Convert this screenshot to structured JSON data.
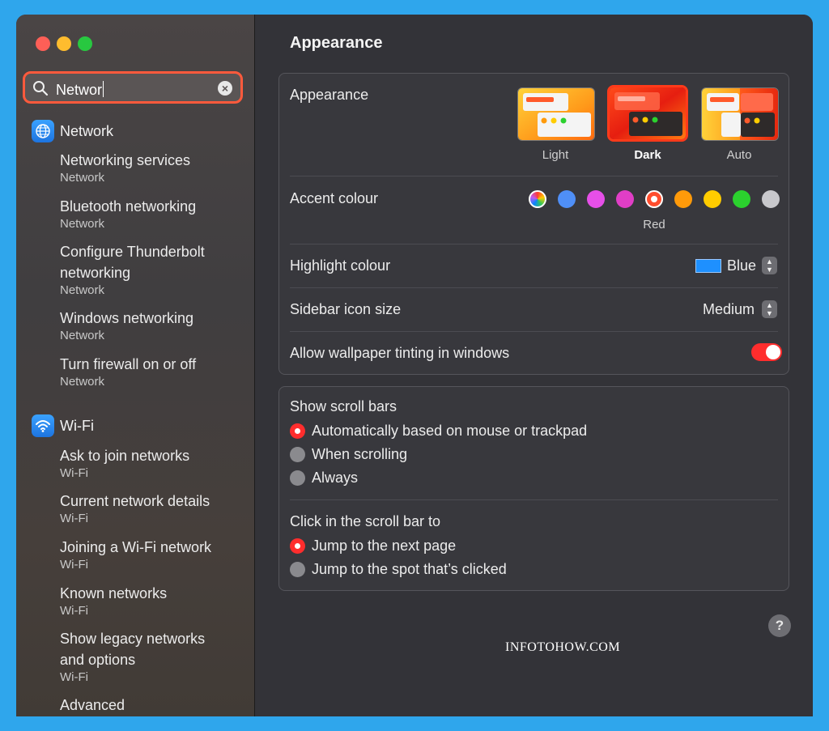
{
  "window": {
    "traffic_colors": [
      "#fe5f57",
      "#febc2e",
      "#28c840"
    ]
  },
  "search": {
    "value": "Networ",
    "clear_glyph": "×"
  },
  "sidebar": {
    "groups": [
      {
        "label": "Network",
        "icon": "globe-icon",
        "results": [
          {
            "title": "Networking services",
            "sub": "Network"
          },
          {
            "title": "Bluetooth networking",
            "sub": "Network"
          },
          {
            "title": "Configure Thunderbolt networking",
            "sub": "Network"
          },
          {
            "title": "Windows networking",
            "sub": "Network"
          },
          {
            "title": "Turn firewall on or off",
            "sub": "Network"
          }
        ]
      },
      {
        "label": "Wi-Fi",
        "icon": "wifi-icon",
        "results": [
          {
            "title": "Ask to join networks",
            "sub": "Wi-Fi"
          },
          {
            "title": "Current network details",
            "sub": "Wi-Fi"
          },
          {
            "title": "Joining a Wi-Fi network",
            "sub": "Wi-Fi"
          },
          {
            "title": "Known networks",
            "sub": "Wi-Fi"
          },
          {
            "title": "Show legacy networks and options",
            "sub": "Wi-Fi"
          },
          {
            "title": "Advanced",
            "sub": ""
          }
        ]
      }
    ]
  },
  "main": {
    "title": "Appearance",
    "appearance": {
      "label": "Appearance",
      "options": [
        {
          "label": "Light",
          "selected": false
        },
        {
          "label": "Dark",
          "selected": true
        },
        {
          "label": "Auto",
          "selected": false
        }
      ]
    },
    "accent": {
      "label": "Accent colour",
      "colors": [
        "multicolor",
        "#4f8ff7",
        "#e64fe8",
        "#e03ec6",
        "#ff4d2e",
        "#ff9a0a",
        "#ffcc00",
        "#2bd12e",
        "#c8c8cc"
      ],
      "selected_name": "Red"
    },
    "highlight": {
      "label": "Highlight colour",
      "value": "Blue",
      "color": "#1e90ff"
    },
    "sidebar_icon_size": {
      "label": "Sidebar icon size",
      "value": "Medium"
    },
    "wallpaper_tinting": {
      "label": "Allow wallpaper tinting in windows",
      "on": true
    },
    "scroll_bars": {
      "label": "Show scroll bars",
      "options": [
        {
          "label": "Automatically based on mouse or trackpad",
          "selected": true
        },
        {
          "label": "When scrolling",
          "selected": false
        },
        {
          "label": "Always",
          "selected": false
        }
      ]
    },
    "click_scroll": {
      "label": "Click in the scroll bar to",
      "options": [
        {
          "label": "Jump to the next page",
          "selected": true
        },
        {
          "label": "Jump to the spot that’s clicked",
          "selected": false
        }
      ]
    },
    "help_glyph": "?"
  },
  "watermark": "INFOTOHOW.COM"
}
